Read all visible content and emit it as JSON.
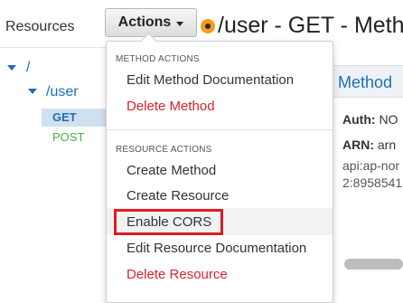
{
  "sidebar": {
    "title": "Resources",
    "tree": {
      "root": "/",
      "user": "/user",
      "methods": [
        "GET",
        "POST"
      ]
    }
  },
  "toolbar": {
    "actions_label": "Actions"
  },
  "header": {
    "title": "/user - GET - Metho"
  },
  "method_panel": {
    "title": "Method",
    "auth_label": "Auth:",
    "auth_value": "NO",
    "arn_label": "ARN:",
    "arn_value_1": "arn",
    "arn_value_2": "api:ap-nor",
    "arn_value_3": "2:8958541"
  },
  "menu": {
    "method_actions_header": "METHOD ACTIONS",
    "method_items": [
      {
        "label": "Edit Method Documentation",
        "danger": false
      },
      {
        "label": "Delete Method",
        "danger": true
      }
    ],
    "resource_actions_header": "RESOURCE ACTIONS",
    "resource_items": [
      {
        "label": "Create Method",
        "danger": false
      },
      {
        "label": "Create Resource",
        "danger": false
      },
      {
        "label": "Enable CORS",
        "danger": false,
        "highlighted": true
      },
      {
        "label": "Edit Resource Documentation",
        "danger": false
      },
      {
        "label": "Delete Resource",
        "danger": true
      }
    ]
  },
  "colors": {
    "link_blue": "#1f6fb5",
    "danger_red": "#d9232d",
    "post_green": "#4cae4c",
    "highlight_box": "#e01b24",
    "method_badge": "#f59a1c"
  }
}
